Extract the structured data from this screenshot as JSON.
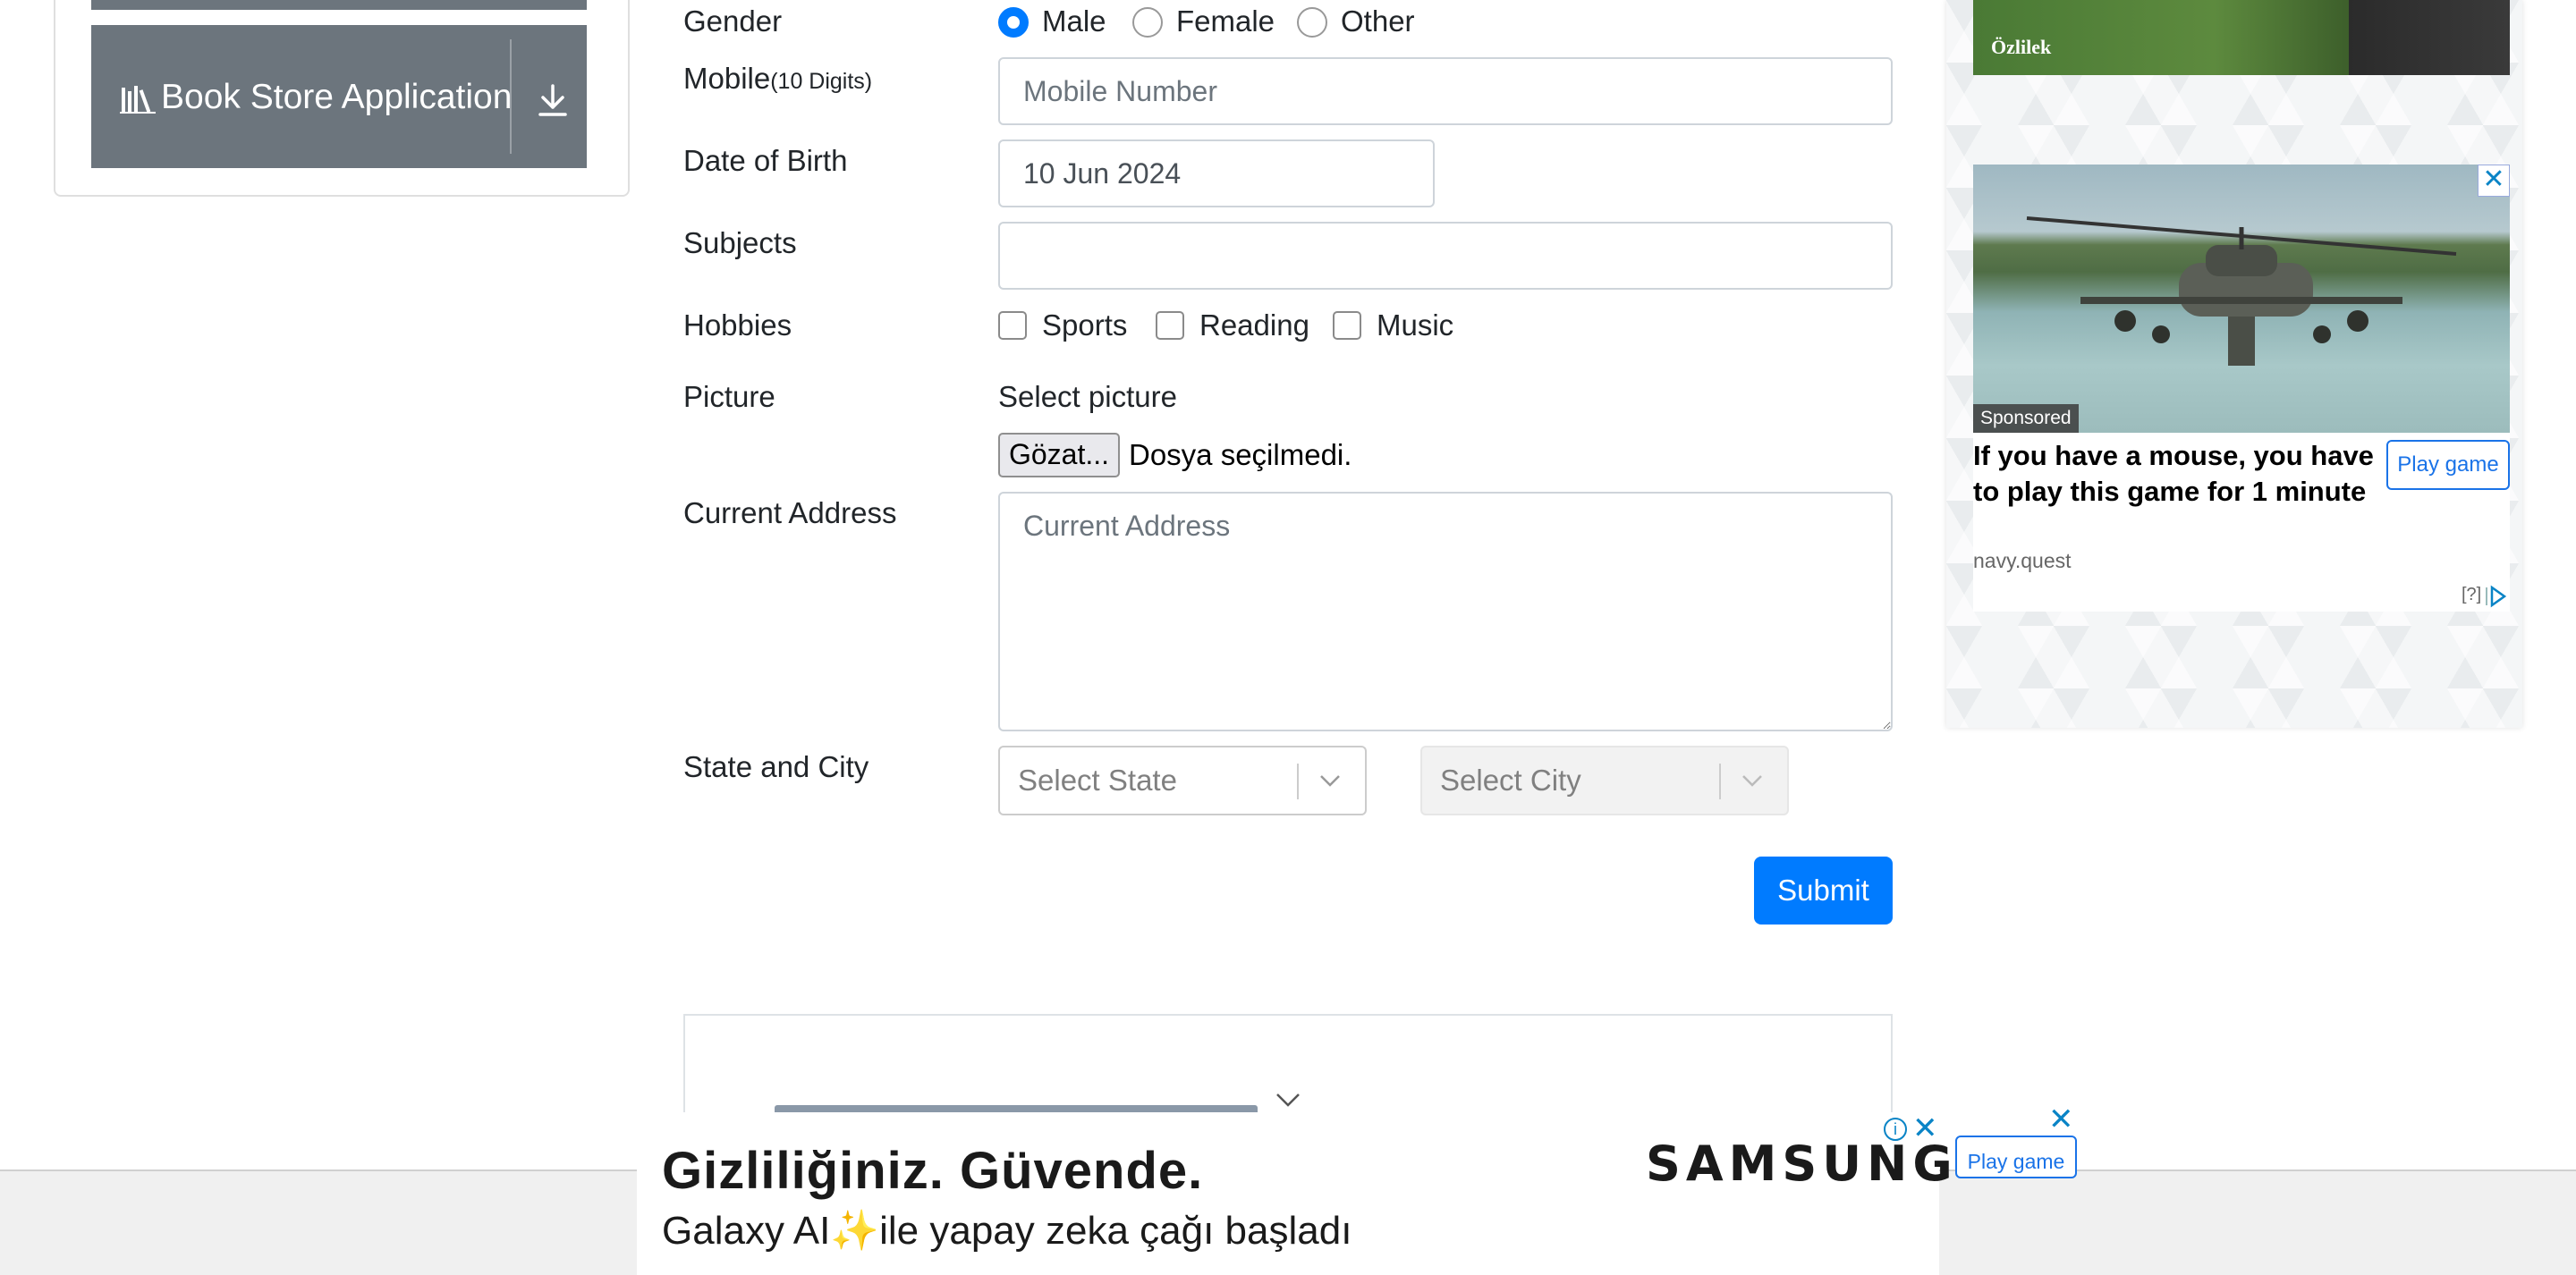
{
  "sidebar": {
    "group": {
      "label": "Book Store Application",
      "icon": "books-icon",
      "action_icon": "download-icon"
    }
  },
  "form": {
    "gender": {
      "label": "Gender",
      "options": [
        "Male",
        "Female",
        "Other"
      ],
      "selected": "Male"
    },
    "mobile": {
      "label": "Mobile",
      "hint": "(10 Digits)",
      "placeholder": "Mobile Number",
      "value": ""
    },
    "dob": {
      "label": "Date of Birth",
      "value": "10 Jun 2024"
    },
    "subjects": {
      "label": "Subjects",
      "value": ""
    },
    "hobbies": {
      "label": "Hobbies",
      "options": [
        "Sports",
        "Reading",
        "Music"
      ],
      "checked": []
    },
    "picture": {
      "label": "Picture",
      "select_text": "Select picture",
      "button": "Gözat...",
      "status": "Dosya seçilmedi."
    },
    "address": {
      "label": "Current Address",
      "placeholder": "Current Address",
      "value": ""
    },
    "state_city": {
      "label": "State and City",
      "state_placeholder": "Select State",
      "city_placeholder": "Select City"
    },
    "submit": "Submit"
  },
  "ads": {
    "top_banner": {
      "brand": "Özlilek"
    },
    "side": {
      "sponsored": "Sponsored",
      "headline": "If you have a mouse, you have to play this game for 1 minute",
      "cta": "Play game",
      "source": "navy.quest",
      "help": "[?]",
      "close": "✕"
    },
    "sticky": {
      "title": "Gizliliğiniz. Güvende.",
      "subtitle_pre": "Galaxy AI",
      "subtitle_post": "ile yapay zeka çağı başladı",
      "brand": "SAMSUNG",
      "info": "i",
      "close": "✕",
      "float_close": "✕",
      "float_cta": "Play game"
    }
  },
  "colors": {
    "primary": "#007bff",
    "sidebar_bg": "#6c757d",
    "ad_link": "#1a73e8"
  }
}
